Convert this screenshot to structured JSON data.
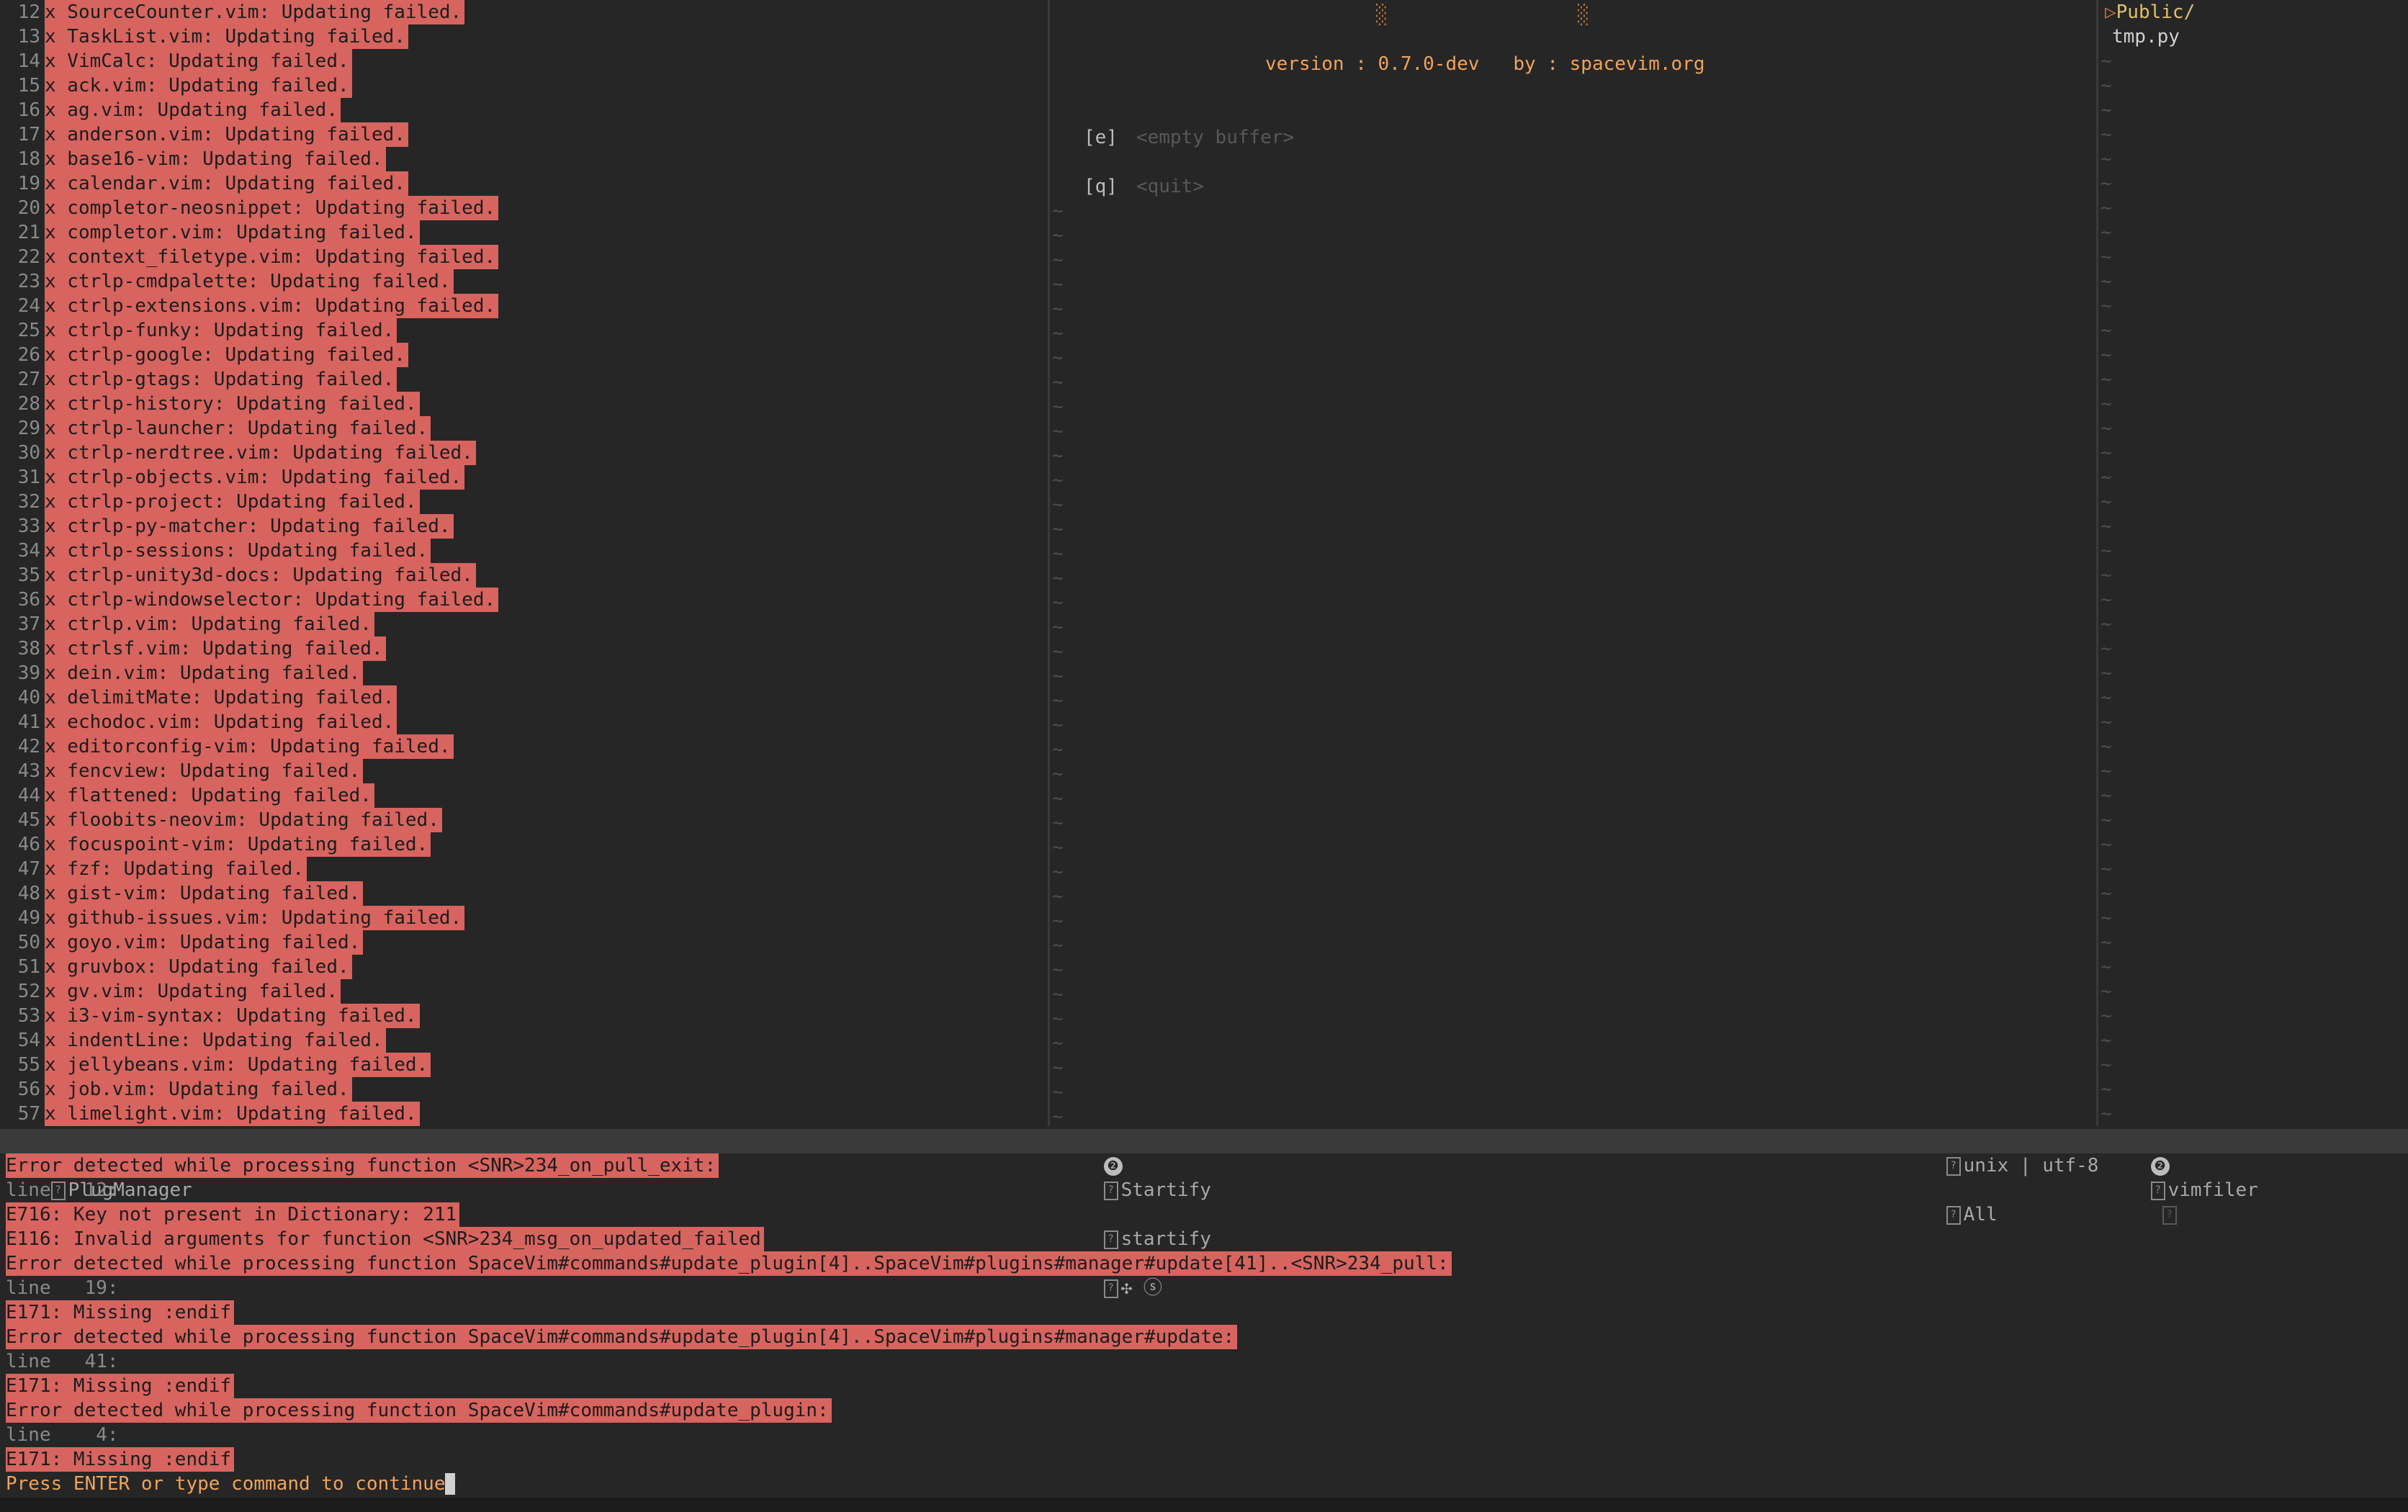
{
  "left_pane": {
    "lines": [
      {
        "num": "12",
        "text": "x SourceCounter.vim: Updating failed."
      },
      {
        "num": "13",
        "text": "x TaskList.vim: Updating failed."
      },
      {
        "num": "14",
        "text": "x VimCalc: Updating failed."
      },
      {
        "num": "15",
        "text": "x ack.vim: Updating failed."
      },
      {
        "num": "16",
        "text": "x ag.vim: Updating failed."
      },
      {
        "num": "17",
        "text": "x anderson.vim: Updating failed."
      },
      {
        "num": "18",
        "text": "x base16-vim: Updating failed."
      },
      {
        "num": "19",
        "text": "x calendar.vim: Updating failed."
      },
      {
        "num": "20",
        "text": "x completor-neosnippet: Updating failed."
      },
      {
        "num": "21",
        "text": "x completor.vim: Updating failed."
      },
      {
        "num": "22",
        "text": "x context_filetype.vim: Updating failed."
      },
      {
        "num": "23",
        "text": "x ctrlp-cmdpalette: Updating failed."
      },
      {
        "num": "24",
        "text": "x ctrlp-extensions.vim: Updating failed."
      },
      {
        "num": "25",
        "text": "x ctrlp-funky: Updating failed."
      },
      {
        "num": "26",
        "text": "x ctrlp-google: Updating failed."
      },
      {
        "num": "27",
        "text": "x ctrlp-gtags: Updating failed."
      },
      {
        "num": "28",
        "text": "x ctrlp-history: Updating failed."
      },
      {
        "num": "29",
        "text": "x ctrlp-launcher: Updating failed."
      },
      {
        "num": "30",
        "text": "x ctrlp-nerdtree.vim: Updating failed."
      },
      {
        "num": "31",
        "text": "x ctrlp-objects.vim: Updating failed."
      },
      {
        "num": "32",
        "text": "x ctrlp-project: Updating failed."
      },
      {
        "num": "33",
        "text": "x ctrlp-py-matcher: Updating failed."
      },
      {
        "num": "34",
        "text": "x ctrlp-sessions: Updating failed."
      },
      {
        "num": "35",
        "text": "x ctrlp-unity3d-docs: Updating failed."
      },
      {
        "num": "36",
        "text": "x ctrlp-windowselector: Updating failed."
      },
      {
        "num": "37",
        "text": "x ctrlp.vim: Updating failed."
      },
      {
        "num": "38",
        "text": "x ctrlsf.vim: Updating failed."
      },
      {
        "num": "39",
        "text": "x dein.vim: Updating failed."
      },
      {
        "num": "40",
        "text": "x delimitMate: Updating failed."
      },
      {
        "num": "41",
        "text": "x echodoc.vim: Updating failed."
      },
      {
        "num": "42",
        "text": "x editorconfig-vim: Updating failed."
      },
      {
        "num": "43",
        "text": "x fencview: Updating failed."
      },
      {
        "num": "44",
        "text": "x flattened: Updating failed."
      },
      {
        "num": "45",
        "text": "x floobits-neovim: Updating failed."
      },
      {
        "num": "46",
        "text": "x focuspoint-vim: Updating failed."
      },
      {
        "num": "47",
        "text": "x fzf: Updating failed."
      },
      {
        "num": "48",
        "text": "x gist-vim: Updating failed."
      },
      {
        "num": "49",
        "text": "x github-issues.vim: Updating failed."
      },
      {
        "num": "50",
        "text": "x goyo.vim: Updating failed."
      },
      {
        "num": "51",
        "text": "x gruvbox: Updating failed."
      },
      {
        "num": "52",
        "text": "x gv.vim: Updating failed."
      },
      {
        "num": "53",
        "text": "x i3-vim-syntax: Updating failed."
      },
      {
        "num": "54",
        "text": "x indentLine: Updating failed."
      },
      {
        "num": "55",
        "text": "x jellybeans.vim: Updating failed."
      },
      {
        "num": "56",
        "text": "x job.vim: Updating failed."
      },
      {
        "num": "57",
        "text": "x limelight.vim: Updating failed."
      }
    ]
  },
  "startify": {
    "banner_blocks": [
      "░",
      "░"
    ],
    "version_text": "version : 0.7.0-dev   by : spacevim.org",
    "entries": [
      {
        "key": "[e]",
        "label": "<empty buffer>"
      },
      {
        "key": "[q]",
        "label": "<quit>"
      }
    ],
    "tilde": "~"
  },
  "vimfiler": {
    "items": [
      {
        "icon": "▷",
        "name": "Public/",
        "type": "dir"
      },
      {
        "icon": "",
        "name": "tmp.py",
        "type": "file"
      }
    ],
    "tilde": "~"
  },
  "statusline": {
    "left": {
      "win": "❶",
      "name": "PlugManager"
    },
    "mid": {
      "win": "❷",
      "name": "Startify",
      "filetype": "startify",
      "icons": "✣ ⓢ",
      "format": "unix | utf-8",
      "pos": "All"
    },
    "right": {
      "win": "❷",
      "name": "vimfiler"
    }
  },
  "messages": [
    {
      "text": "Error detected while processing function <SNR>234_on_pull_exit:",
      "style": "err"
    },
    {
      "text": "line   12:",
      "style": "line"
    },
    {
      "text": "E716: Key not present in Dictionary: 211",
      "style": "err"
    },
    {
      "text": "E116: Invalid arguments for function <SNR>234_msg_on_updated_failed",
      "style": "err"
    },
    {
      "text": "Error detected while processing function SpaceVim#commands#update_plugin[4]..SpaceVim#plugins#manager#update[41]..<SNR>234_pull:",
      "style": "err"
    },
    {
      "text": "line   19:",
      "style": "line"
    },
    {
      "text": "E171: Missing :endif",
      "style": "err"
    },
    {
      "text": "Error detected while processing function SpaceVim#commands#update_plugin[4]..SpaceVim#plugins#manager#update:",
      "style": "err"
    },
    {
      "text": "line   41:",
      "style": "line"
    },
    {
      "text": "E171: Missing :endif",
      "style": "err"
    },
    {
      "text": "Error detected while processing function SpaceVim#commands#update_plugin:",
      "style": "err"
    },
    {
      "text": "line    4:",
      "style": "line"
    },
    {
      "text": "E171: Missing :endif",
      "style": "err"
    }
  ],
  "prompt": "Press ENTER or type command to continue"
}
